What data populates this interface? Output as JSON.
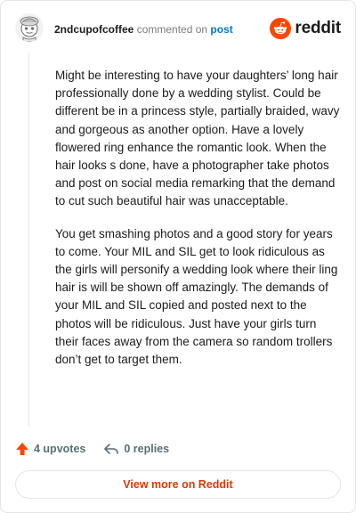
{
  "header": {
    "username": "2ndcupofcoffee",
    "commented_text": "commented on",
    "post_link": "post",
    "brand_name": "reddit",
    "brand_color": "#ff4500",
    "avatar_icon": "snoo-avatar-icon"
  },
  "comment": {
    "paragraphs": [
      "Might be interesting to have your daughters’ long hair professionally done by a wedding stylist. Could be different be in a princess style, partially braided, wavy and gorgeous as another option. Have a lovely flowered ring enhance the romantic look. When the hair looks s done, have a photographer take photos and post on social media remarking that the demand to cut such beautiful hair was unacceptable.",
      "You get smashing photos and a good story for years to come. Your MIL and SIL get to look ridiculous as the girls will personify a wedding look where their ling hair is will be shown off amazingly. The demands of your MIL and SIL copied and posted next to the photos will be ridiculous. Just have your girls turn their faces away from the camera so random trollers don’t get to target them."
    ]
  },
  "footer": {
    "upvotes_label": "4 upvotes",
    "replies_label": "0 replies",
    "view_more_label": "View more on Reddit",
    "upvote_icon": "upvote-arrow-icon",
    "reply_icon": "reply-arrow-icon",
    "accent_color": "#d93a00"
  }
}
